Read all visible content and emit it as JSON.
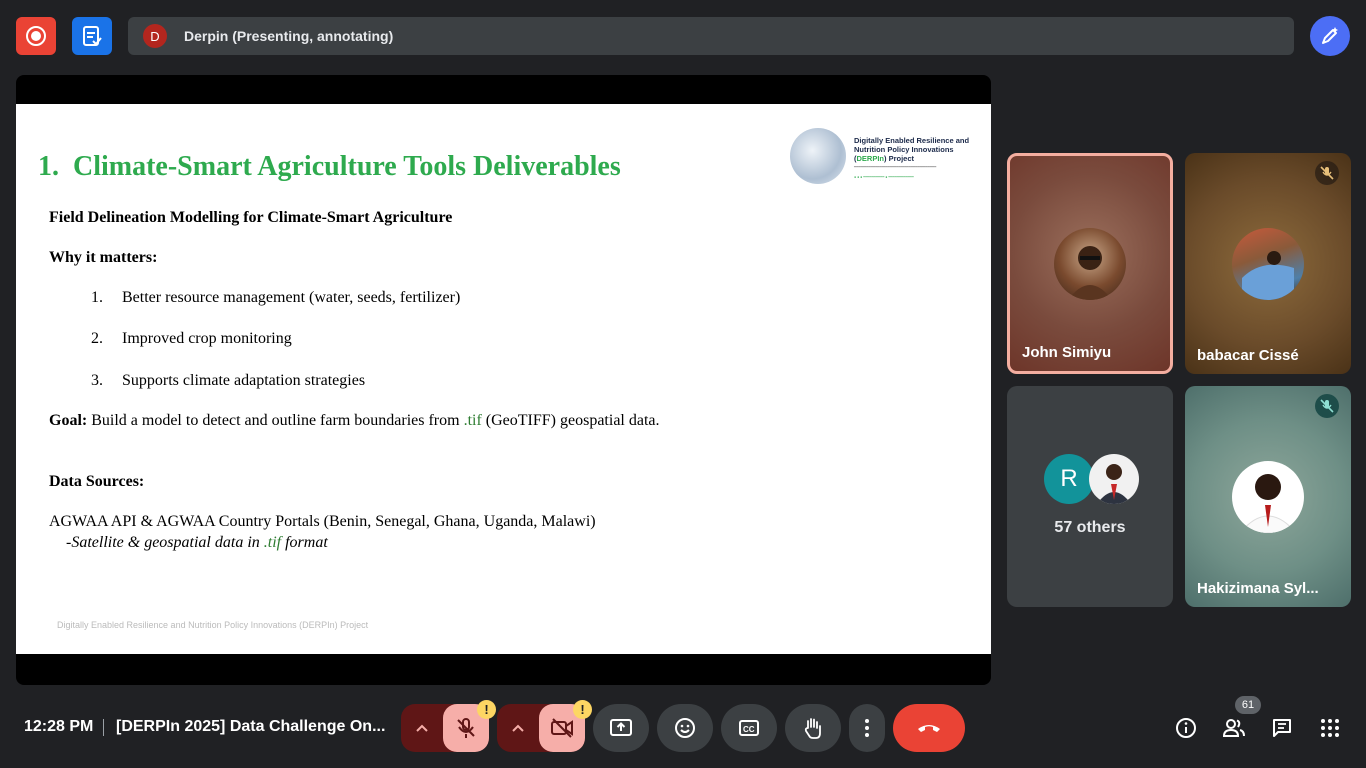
{
  "top_bar": {
    "presenter_initial": "D",
    "presenter_label": "Derpin (Presenting, annotating)",
    "record_icon": "record-icon",
    "notes_icon": "notes-icon",
    "annotate_icon": "pen-icon"
  },
  "slide": {
    "title_number": "1.",
    "title": "Climate-Smart Agriculture Tools Deliverables",
    "logo": {
      "title_line1": "Digitally Enabled Resilience and",
      "title_line2": "Nutrition Policy Innovations",
      "title_line3_open": "(",
      "title_line3_green": "DERPIn",
      "title_line3_close": ") Project"
    },
    "subtitle": "Field Delineation Modelling for Climate-Smart Agriculture",
    "why_heading": "Why it matters:",
    "list": [
      {
        "num": "1.",
        "text": "Better resource management (water, seeds, fertilizer)"
      },
      {
        "num": "2.",
        "text": "Improved crop monitoring"
      },
      {
        "num": "3.",
        "text": "Supports climate adaptation strategies"
      }
    ],
    "goal_label": "Goal:",
    "goal_text_before": " Build a model to detect and outline farm boundaries from ",
    "goal_ext": ".tif",
    "goal_text_after": " (GeoTIFF) geospatial data.",
    "sources_heading": "Data Sources:",
    "sources_line": "AGWAA API & AGWAA Country Portals (Benin, Senegal, Ghana, Uganda, Malawi)",
    "sources_sub_before": "-Satellite & geospatial data in ",
    "sources_sub_ext": ".tif",
    "sources_sub_after": " format",
    "footer": "Digitally Enabled Resilience and Nutrition Policy Innovations (DERPIn) Project"
  },
  "participants": [
    {
      "name": "John Simiyu",
      "muted": false,
      "active_speaker": true
    },
    {
      "name": "babacar Cissé",
      "muted": true
    },
    {
      "name": "57 others",
      "initial": "R"
    },
    {
      "name": "Hakizimana Syl...",
      "muted": true
    }
  ],
  "bottom_bar": {
    "time": "12:28 PM",
    "meeting_title": "[DERPIn 2025] Data Challenge On...",
    "warning_mark": "!",
    "people_count": "61"
  },
  "colors": {
    "accent_green": "#2eaa4e",
    "end_call": "#ea4335",
    "record": "#ea4335",
    "notes": "#1a73e8"
  }
}
